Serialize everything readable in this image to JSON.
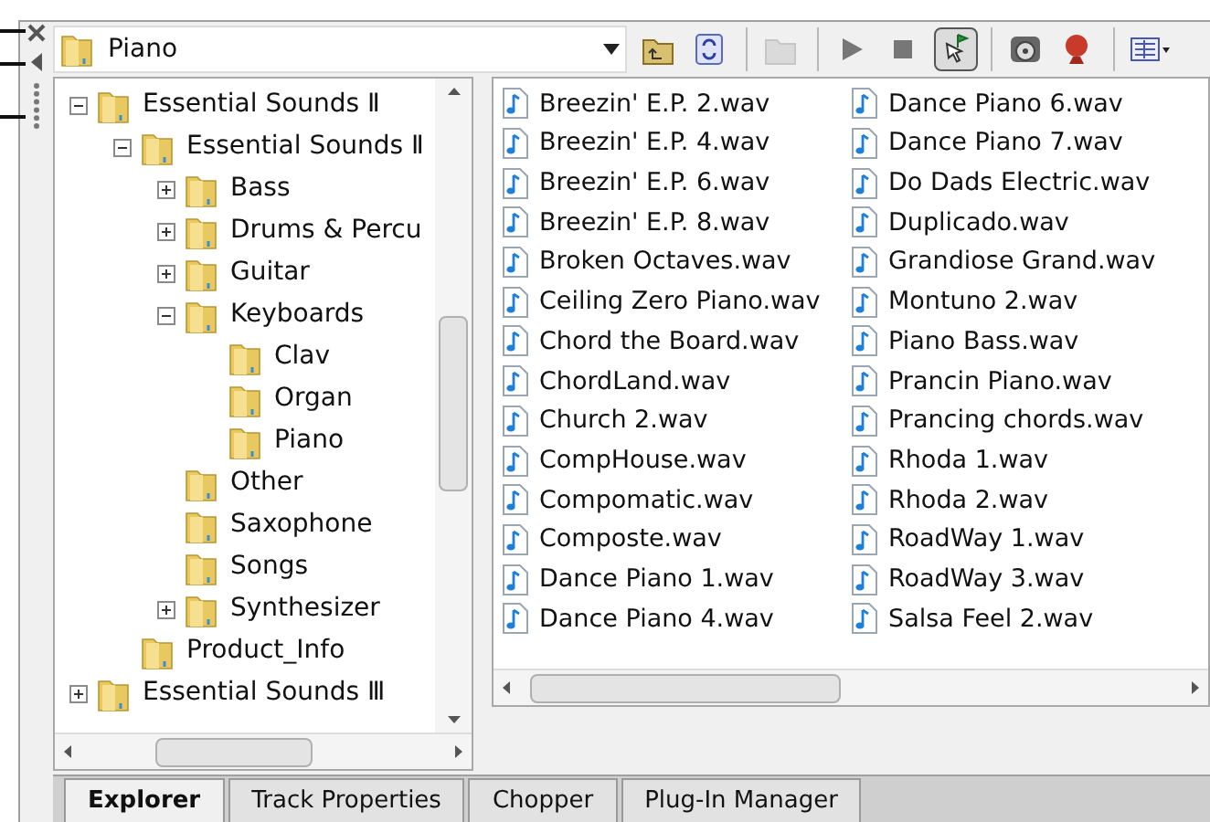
{
  "location": {
    "value": "Piano"
  },
  "toolbar": [
    [
      {
        "disabled": false,
        "pressed": false
      },
      {
        "disabled": false,
        "pressed": false
      }
    ],
    [
      {
        "disabled": true,
        "pressed": false
      }
    ],
    [
      {
        "disabled": false,
        "pressed": false
      },
      {
        "disabled": false,
        "pressed": false
      },
      {
        "disabled": false,
        "pressed": true
      }
    ],
    [
      {
        "disabled": false,
        "pressed": false
      },
      {
        "disabled": false,
        "pressed": false
      }
    ],
    [
      {
        "disabled": false,
        "pressed": false
      }
    ]
  ],
  "tree": [
    {
      "label": "Essential Sounds Ⅱ",
      "expanded": true,
      "children": [
        {
          "label": "Essential Sounds Ⅱ",
          "expanded": true,
          "children": [
            {
              "label": "Bass",
              "expanded": false
            },
            {
              "label": "Drums & Percu",
              "expanded": false
            },
            {
              "label": "Guitar",
              "expanded": false
            },
            {
              "label": "Keyboards",
              "expanded": true,
              "children": [
                {
                  "label": "Clav"
                },
                {
                  "label": "Organ"
                },
                {
                  "label": "Piano"
                }
              ]
            },
            {
              "label": "Other"
            },
            {
              "label": "Saxophone"
            },
            {
              "label": "Songs"
            },
            {
              "label": "Synthesizer",
              "expanded": false
            }
          ]
        },
        {
          "label": "Product_Info"
        }
      ]
    },
    {
      "label": "Essential Sounds Ⅲ",
      "expanded": false
    }
  ],
  "files": [
    [
      "Breezin' E.P. 2.wav",
      "Breezin' E.P. 4.wav",
      "Breezin' E.P. 6.wav",
      "Breezin' E.P. 8.wav",
      "Broken Octaves.wav",
      "Ceiling Zero Piano.wav",
      "Chord the Board.wav",
      "ChordLand.wav",
      "Church 2.wav",
      "CompHouse.wav",
      "Compomatic.wav",
      "Composte.wav",
      "Dance Piano 1.wav",
      "Dance Piano 4.wav"
    ],
    [
      "Dance Piano 6.wav",
      "Dance Piano 7.wav",
      "Do Dads Electric.wav",
      "Duplicado.wav",
      "Grandiose Grand.wav",
      "Montuno 2.wav",
      "Piano Bass.wav",
      "Prancin Piano.wav",
      "Prancing chords.wav",
      "Rhoda 1.wav",
      "Rhoda 2.wav",
      "RoadWay 1.wav",
      "RoadWay 3.wav",
      "Salsa Feel 2.wav"
    ]
  ],
  "tabs": [
    {
      "label": "Explorer",
      "selected": true
    },
    {
      "label": "Track Properties",
      "selected": false
    },
    {
      "label": "Chopper",
      "selected": false
    },
    {
      "label": "Plug-In Manager",
      "selected": false
    }
  ]
}
